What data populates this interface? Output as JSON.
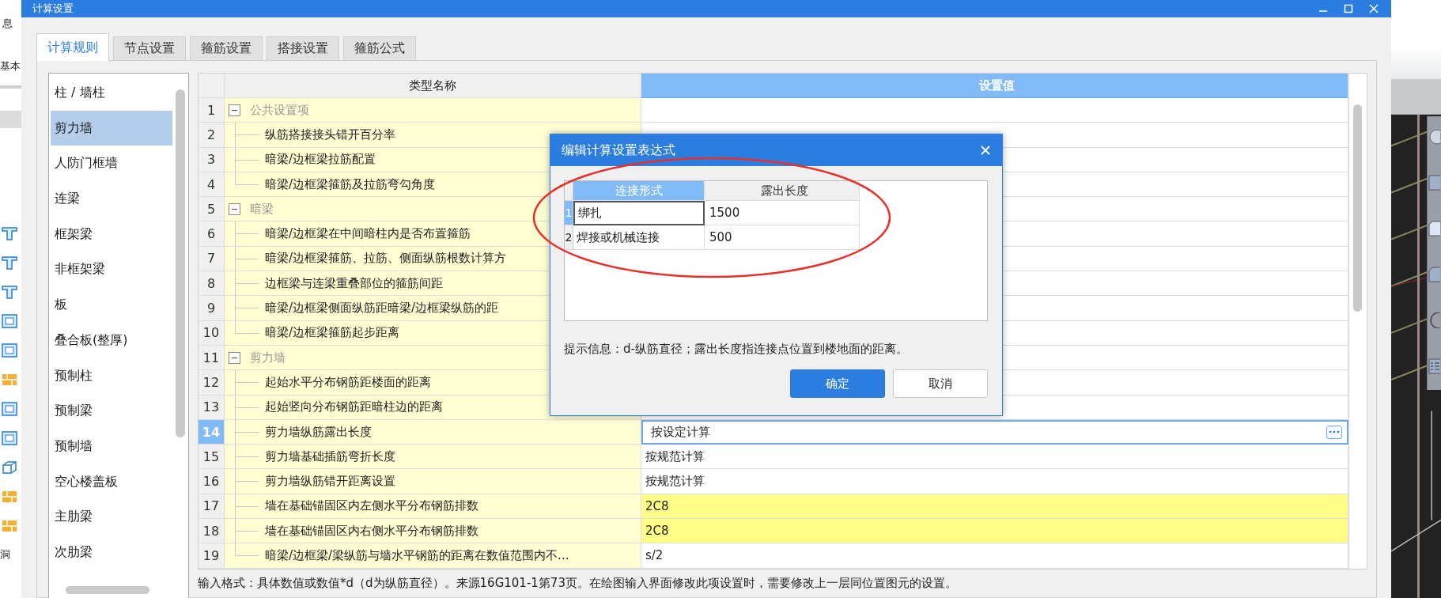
{
  "window": {
    "title": "计算设置"
  },
  "background_app": {
    "labels": [
      "息",
      "基本",
      "洞"
    ]
  },
  "tabs": [
    {
      "label": "计算规则",
      "selected": true
    },
    {
      "label": "节点设置",
      "selected": false
    },
    {
      "label": "箍筋设置",
      "selected": false
    },
    {
      "label": "搭接设置",
      "selected": false
    },
    {
      "label": "箍筋公式",
      "selected": false
    }
  ],
  "categories": [
    {
      "label": "柱 / 墙柱",
      "selected": false
    },
    {
      "label": "剪力墙",
      "selected": true
    },
    {
      "label": "人防门框墙",
      "selected": false
    },
    {
      "label": "连梁",
      "selected": false
    },
    {
      "label": "框架梁",
      "selected": false
    },
    {
      "label": "非框架梁",
      "selected": false
    },
    {
      "label": "板",
      "selected": false
    },
    {
      "label": "叠合板(整厚)",
      "selected": false
    },
    {
      "label": "预制柱",
      "selected": false
    },
    {
      "label": "预制梁",
      "selected": false
    },
    {
      "label": "预制墙",
      "selected": false
    },
    {
      "label": "空心楼盖板",
      "selected": false
    },
    {
      "label": "主肋梁",
      "selected": false
    },
    {
      "label": "次肋梁",
      "selected": false
    }
  ],
  "table": {
    "columns": [
      "类型名称",
      "设置值"
    ],
    "rows": [
      {
        "number": "1",
        "name": "公共设置项",
        "expanded": true,
        "selected": false,
        "highlighted": false,
        "children": [
          {
            "number": "2",
            "name": "纵筋搭接接头错开百分率",
            "selected": false,
            "highlighted": false
          },
          {
            "number": "3",
            "name": "暗梁/边框梁拉筋配置",
            "selected": false,
            "highlighted": false
          },
          {
            "number": "4",
            "name": "暗梁/边框梁箍筋及拉筋弯勾角度",
            "selected": false,
            "highlighted": false
          }
        ]
      },
      {
        "number": "5",
        "name": "暗梁",
        "expanded": true,
        "selected": false,
        "highlighted": false,
        "children": [
          {
            "number": "6",
            "name": "暗梁/边框梁在中间暗柱内是否布置箍筋",
            "selected": false,
            "highlighted": false
          },
          {
            "number": "7",
            "name": "暗梁/边框梁箍筋、拉筋、侧面纵筋根数计算方",
            "selected": false,
            "highlighted": false
          },
          {
            "number": "8",
            "name": "边框梁与连梁重叠部位的箍筋间距",
            "selected": false,
            "highlighted": false
          },
          {
            "number": "9",
            "name": "暗梁/边框梁侧面纵筋距暗梁/边框梁纵筋的距",
            "selected": false,
            "highlighted": false
          },
          {
            "number": "10",
            "name": "暗梁/边框梁箍筋起步距离",
            "selected": false,
            "highlighted": false
          }
        ]
      },
      {
        "number": "11",
        "name": "剪力墙",
        "expanded": true,
        "selected": false,
        "highlighted": false,
        "children": [
          {
            "number": "12",
            "name": "起始水平分布钢筋距楼面的距离",
            "selected": false,
            "highlighted": false
          },
          {
            "number": "13",
            "name": "起始竖向分布钢筋距暗柱边的距离",
            "selected": false,
            "highlighted": false
          },
          {
            "number": "14",
            "name": "剪力墙纵筋露出长度",
            "value": "按设定计算",
            "selected": true,
            "highlighted": false
          },
          {
            "number": "15",
            "name": "剪力墙基础插筋弯折长度",
            "value": "按规范计算",
            "selected": false,
            "highlighted": false
          },
          {
            "number": "16",
            "name": "剪力墙纵筋错开距离设置",
            "value": "按规范计算",
            "selected": false,
            "highlighted": false
          },
          {
            "number": "17",
            "name": "墙在基础锚固区内左侧水平分布钢筋排数",
            "value": "2C8",
            "selected": false,
            "highlighted": true
          },
          {
            "number": "18",
            "name": "墙在基础锚固区内右侧水平分布钢筋排数",
            "value": "2C8",
            "selected": false,
            "highlighted": true
          },
          {
            "number": "19",
            "name": "暗梁/边框梁/梁纵筋与墙水平钢筋的距离在数值范围内不...",
            "value": "s/2",
            "selected": false,
            "highlighted": false
          }
        ]
      }
    ]
  },
  "hint": "输入格式：具体数值或数值*d（d为纵筋直径）。来源16G101-1第73页。在绘图输入界面修改此项设置时，需要修改上一层同位置图元的设置。",
  "dialog": {
    "title": "编辑计算设置表达式",
    "columns": [
      {
        "label": "连接形式",
        "selected": true
      },
      {
        "label": "露出长度",
        "selected": false
      }
    ],
    "rows": [
      {
        "number": "1",
        "selected": true,
        "cells": [
          "绑扎",
          "1500"
        ]
      },
      {
        "number": "2",
        "selected": false,
        "cells": [
          "焊接或机械连接",
          "500"
        ]
      }
    ],
    "hint": "提示信息：d-纵筋直径；露出长度指连接点位置到楼地面的距离。",
    "buttons": [
      {
        "label": "确定",
        "kind": "primary"
      },
      {
        "label": "取消",
        "kind": "secondary"
      }
    ]
  }
}
